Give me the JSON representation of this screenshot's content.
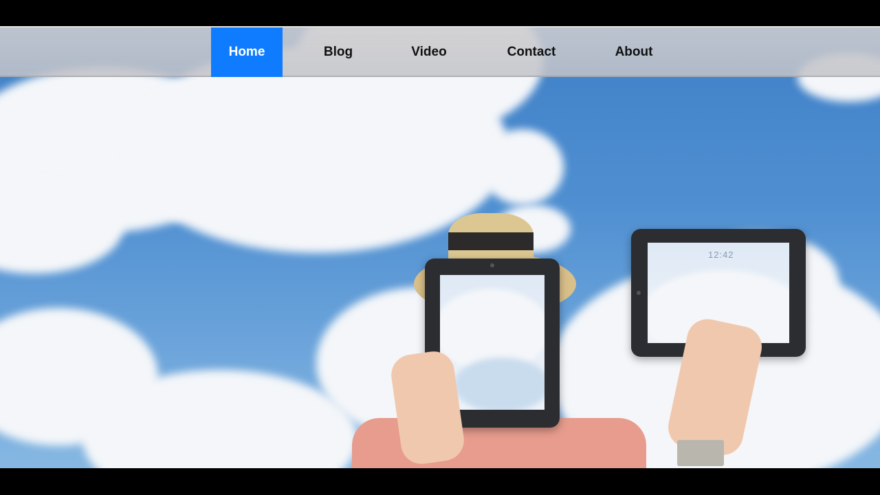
{
  "nav": {
    "items": [
      {
        "label": "Home",
        "active": true
      },
      {
        "label": "Blog",
        "active": false
      },
      {
        "label": "Video",
        "active": false
      },
      {
        "label": "Contact",
        "active": false
      },
      {
        "label": "About",
        "active": false
      }
    ]
  },
  "hero": {
    "tablet_clock": "12:42"
  },
  "colors": {
    "nav_active": "#0f7bff",
    "nav_bar": "#c8c8cc",
    "sky": "#4f8fd1"
  }
}
